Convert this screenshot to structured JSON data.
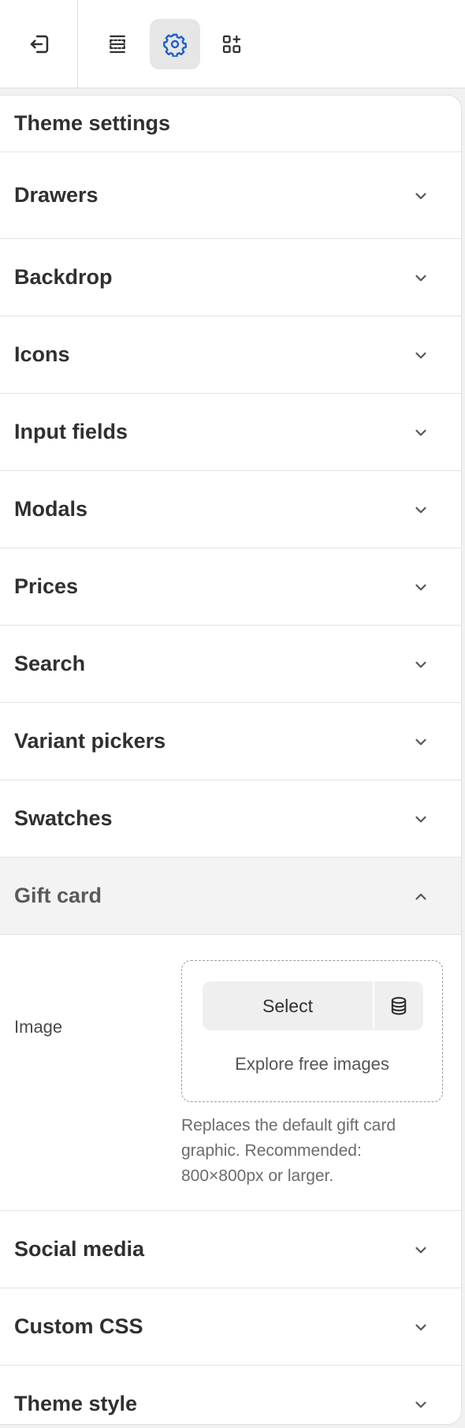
{
  "topbar": {
    "exit_icon": "exit-icon",
    "tools": [
      {
        "id": "sections",
        "icon": "sections-icon",
        "active": false
      },
      {
        "id": "settings",
        "icon": "gear-icon",
        "active": true
      },
      {
        "id": "apps",
        "icon": "apps-icon",
        "active": false
      }
    ],
    "active_color": "#1f5fc9"
  },
  "panel": {
    "title": "Theme settings",
    "sections_before": [
      {
        "label": "Drawers"
      },
      {
        "label": "Backdrop"
      },
      {
        "label": "Icons"
      },
      {
        "label": "Input fields"
      },
      {
        "label": "Modals"
      },
      {
        "label": "Prices"
      },
      {
        "label": "Search"
      },
      {
        "label": "Variant pickers"
      },
      {
        "label": "Swatches"
      }
    ],
    "open_section": {
      "label": "Gift card",
      "image_label": "Image",
      "select_label": "Select",
      "explore_label": "Explore free images",
      "help_text": "Replaces the default gift card graphic. Recommended: 800×800px or larger."
    },
    "sections_after": [
      {
        "label": "Social media"
      },
      {
        "label": "Custom CSS"
      },
      {
        "label": "Theme style"
      }
    ]
  }
}
